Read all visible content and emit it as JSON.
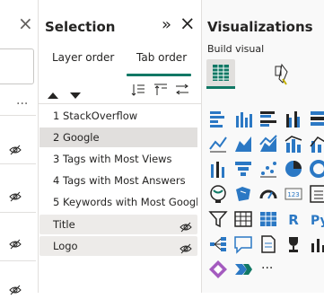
{
  "left_panel": {
    "close_glyph": "×",
    "more_glyph": "..."
  },
  "selection": {
    "title": "Selection",
    "expand_glyph": "»",
    "close_glyph": "×",
    "tabs": [
      {
        "label": "Layer order"
      },
      {
        "label": "Tab order",
        "active": true
      }
    ],
    "items": [
      {
        "label": "1 StackOverflow"
      },
      {
        "label": "2 Google",
        "selected": true
      },
      {
        "label": "3 Tags with Most Views"
      },
      {
        "label": "4 Tags with Most Answers"
      },
      {
        "label": "5 Keywords with Most Googl..."
      }
    ],
    "groups": [
      {
        "label": "Title"
      },
      {
        "label": "Logo"
      }
    ]
  },
  "visualizations": {
    "title": "Visualizations",
    "build_visual_label": "Build visual",
    "more_label": "..."
  },
  "colors": {
    "accent": "#117865",
    "icon_blue": "#2b78c4",
    "selected_bg": "#e1dfdd"
  }
}
